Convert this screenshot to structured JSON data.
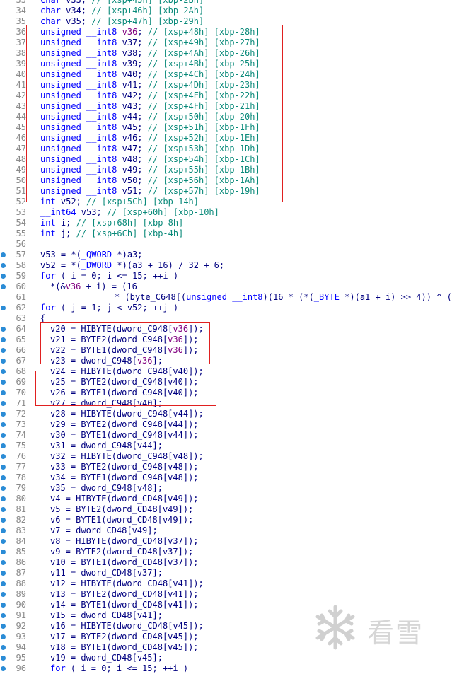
{
  "code_lines": [
    {
      "n": "33",
      "dot": false,
      "indent": 0,
      "tokens": [
        [
          "kw",
          "char"
        ],
        [
          "d",
          " v33; "
        ],
        [
          "com",
          "// [xsp+45h] [xbp-2Bh]"
        ]
      ]
    },
    {
      "n": "34",
      "dot": false,
      "indent": 0,
      "tokens": [
        [
          "kw",
          "char"
        ],
        [
          "d",
          " v34; "
        ],
        [
          "com",
          "// [xsp+46h] [xbp-2Ah]"
        ]
      ]
    },
    {
      "n": "35",
      "dot": false,
      "indent": 0,
      "tokens": [
        [
          "kw",
          "char"
        ],
        [
          "d",
          " v35; "
        ],
        [
          "com",
          "// [xsp+47h] [xbp-29h]"
        ]
      ]
    },
    {
      "n": "36",
      "dot": false,
      "indent": 0,
      "tokens": [
        [
          "kw",
          "unsigned"
        ],
        [
          "d",
          " "
        ],
        [
          "kw",
          "__int8"
        ],
        [
          "d",
          " "
        ],
        [
          "hl",
          "v36"
        ],
        [
          "d",
          "; "
        ],
        [
          "com",
          "// [xsp+48h] [xbp-28h]"
        ]
      ]
    },
    {
      "n": "37",
      "dot": false,
      "indent": 0,
      "tokens": [
        [
          "kw",
          "unsigned"
        ],
        [
          "d",
          " "
        ],
        [
          "kw",
          "__int8"
        ],
        [
          "d",
          " v37; "
        ],
        [
          "com",
          "// [xsp+49h] [xbp-27h]"
        ]
      ]
    },
    {
      "n": "38",
      "dot": false,
      "indent": 0,
      "tokens": [
        [
          "kw",
          "unsigned"
        ],
        [
          "d",
          " "
        ],
        [
          "kw",
          "__int8"
        ],
        [
          "d",
          " v38; "
        ],
        [
          "com",
          "// [xsp+4Ah] [xbp-26h]"
        ]
      ]
    },
    {
      "n": "39",
      "dot": false,
      "indent": 0,
      "tokens": [
        [
          "kw",
          "unsigned"
        ],
        [
          "d",
          " "
        ],
        [
          "kw",
          "__int8"
        ],
        [
          "d",
          " v39; "
        ],
        [
          "com",
          "// [xsp+4Bh] [xbp-25h]"
        ]
      ]
    },
    {
      "n": "40",
      "dot": false,
      "indent": 0,
      "tokens": [
        [
          "kw",
          "unsigned"
        ],
        [
          "d",
          " "
        ],
        [
          "kw",
          "__int8"
        ],
        [
          "d",
          " v40; "
        ],
        [
          "com",
          "// [xsp+4Ch] [xbp-24h]"
        ]
      ]
    },
    {
      "n": "41",
      "dot": false,
      "indent": 0,
      "tokens": [
        [
          "kw",
          "unsigned"
        ],
        [
          "d",
          " "
        ],
        [
          "kw",
          "__int8"
        ],
        [
          "d",
          " v41; "
        ],
        [
          "com",
          "// [xsp+4Dh] [xbp-23h]"
        ]
      ]
    },
    {
      "n": "42",
      "dot": false,
      "indent": 0,
      "tokens": [
        [
          "kw",
          "unsigned"
        ],
        [
          "d",
          " "
        ],
        [
          "kw",
          "__int8"
        ],
        [
          "d",
          " v42; "
        ],
        [
          "com",
          "// [xsp+4Eh] [xbp-22h]"
        ]
      ]
    },
    {
      "n": "43",
      "dot": false,
      "indent": 0,
      "tokens": [
        [
          "kw",
          "unsigned"
        ],
        [
          "d",
          " "
        ],
        [
          "kw",
          "__int8"
        ],
        [
          "d",
          " v43; "
        ],
        [
          "com",
          "// [xsp+4Fh] [xbp-21h]"
        ]
      ]
    },
    {
      "n": "44",
      "dot": false,
      "indent": 0,
      "tokens": [
        [
          "kw",
          "unsigned"
        ],
        [
          "d",
          " "
        ],
        [
          "kw",
          "__int8"
        ],
        [
          "d",
          " v44; "
        ],
        [
          "com",
          "// [xsp+50h] [xbp-20h]"
        ]
      ]
    },
    {
      "n": "45",
      "dot": false,
      "indent": 0,
      "tokens": [
        [
          "kw",
          "unsigned"
        ],
        [
          "d",
          " "
        ],
        [
          "kw",
          "__int8"
        ],
        [
          "d",
          " v45; "
        ],
        [
          "com",
          "// [xsp+51h] [xbp-1Fh]"
        ]
      ]
    },
    {
      "n": "46",
      "dot": false,
      "indent": 0,
      "tokens": [
        [
          "kw",
          "unsigned"
        ],
        [
          "d",
          " "
        ],
        [
          "kw",
          "__int8"
        ],
        [
          "d",
          " v46; "
        ],
        [
          "com",
          "// [xsp+52h] [xbp-1Eh]"
        ]
      ]
    },
    {
      "n": "47",
      "dot": false,
      "indent": 0,
      "tokens": [
        [
          "kw",
          "unsigned"
        ],
        [
          "d",
          " "
        ],
        [
          "kw",
          "__int8"
        ],
        [
          "d",
          " v47; "
        ],
        [
          "com",
          "// [xsp+53h] [xbp-1Dh]"
        ]
      ]
    },
    {
      "n": "48",
      "dot": false,
      "indent": 0,
      "tokens": [
        [
          "kw",
          "unsigned"
        ],
        [
          "d",
          " "
        ],
        [
          "kw",
          "__int8"
        ],
        [
          "d",
          " v48; "
        ],
        [
          "com",
          "// [xsp+54h] [xbp-1Ch]"
        ]
      ]
    },
    {
      "n": "49",
      "dot": false,
      "indent": 0,
      "tokens": [
        [
          "kw",
          "unsigned"
        ],
        [
          "d",
          " "
        ],
        [
          "kw",
          "__int8"
        ],
        [
          "d",
          " v49; "
        ],
        [
          "com",
          "// [xsp+55h] [xbp-1Bh]"
        ]
      ]
    },
    {
      "n": "50",
      "dot": false,
      "indent": 0,
      "tokens": [
        [
          "kw",
          "unsigned"
        ],
        [
          "d",
          " "
        ],
        [
          "kw",
          "__int8"
        ],
        [
          "d",
          " v50; "
        ],
        [
          "com",
          "// [xsp+56h] [xbp-1Ah]"
        ]
      ]
    },
    {
      "n": "51",
      "dot": false,
      "indent": 0,
      "tokens": [
        [
          "kw",
          "unsigned"
        ],
        [
          "d",
          " "
        ],
        [
          "kw",
          "__int8"
        ],
        [
          "d",
          " v51; "
        ],
        [
          "com",
          "// [xsp+57h] [xbp-19h]"
        ]
      ]
    },
    {
      "n": "52",
      "dot": false,
      "indent": 0,
      "tokens": [
        [
          "kw",
          "int"
        ],
        [
          "d",
          " v52; "
        ],
        [
          "com",
          "// [xsp+5Ch] [xbp-14h]"
        ]
      ]
    },
    {
      "n": "53",
      "dot": false,
      "indent": 0,
      "tokens": [
        [
          "kw",
          "__int64"
        ],
        [
          "d",
          " v53; "
        ],
        [
          "com",
          "// [xsp+60h] [xbp-10h]"
        ]
      ]
    },
    {
      "n": "54",
      "dot": false,
      "indent": 0,
      "tokens": [
        [
          "kw",
          "int"
        ],
        [
          "d",
          " i; "
        ],
        [
          "com",
          "// [xsp+68h] [xbp-8h]"
        ]
      ]
    },
    {
      "n": "55",
      "dot": false,
      "indent": 0,
      "tokens": [
        [
          "kw",
          "int"
        ],
        [
          "d",
          " j; "
        ],
        [
          "com",
          "// [xsp+6Ch] [xbp-4h]"
        ]
      ]
    },
    {
      "n": "56",
      "dot": false,
      "indent": 0,
      "tokens": []
    },
    {
      "n": "57",
      "dot": true,
      "indent": 0,
      "tokens": [
        [
          "d",
          "v53 = *("
        ],
        [
          "kw",
          "_QWORD"
        ],
        [
          "d",
          " *)a3;"
        ]
      ]
    },
    {
      "n": "58",
      "dot": true,
      "indent": 0,
      "tokens": [
        [
          "d",
          "v52 = *("
        ],
        [
          "kw",
          "_DWORD"
        ],
        [
          "d",
          " *)(a3 + 16) / 32 + 6;"
        ]
      ]
    },
    {
      "n": "59",
      "dot": true,
      "indent": 0,
      "tokens": [
        [
          "kw",
          "for"
        ],
        [
          "d",
          " ( i = 0; i <= 15; ++i )"
        ]
      ]
    },
    {
      "n": "60",
      "dot": true,
      "indent": 2,
      "tokens": [
        [
          "d",
          "*(&"
        ],
        [
          "hl",
          "v36"
        ],
        [
          "d",
          " + i) = (16"
        ]
      ]
    },
    {
      "n": "61",
      "dot": false,
      "indent": 15,
      "tokens": [
        [
          "d",
          "* (byte_C648[("
        ],
        [
          "kw",
          "unsigned"
        ],
        [
          "d",
          " "
        ],
        [
          "kw",
          "__int8"
        ],
        [
          "d",
          ")(16 * (*("
        ],
        [
          "kw",
          "_BYTE"
        ],
        [
          "d",
          " *)(a1 + i) >> 4)) ^ (*("
        ]
      ]
    },
    {
      "n": "62",
      "dot": true,
      "indent": 0,
      "tokens": [
        [
          "kw",
          "for"
        ],
        [
          "d",
          " ( j = 1; j < v52; ++j )"
        ]
      ]
    },
    {
      "n": "63",
      "dot": false,
      "indent": 0,
      "tokens": [
        [
          "d",
          "{"
        ]
      ]
    },
    {
      "n": "64",
      "dot": true,
      "indent": 2,
      "tokens": [
        [
          "d",
          "v20 = HIBYTE(dword_C948["
        ],
        [
          "hl",
          "v36"
        ],
        [
          "d",
          "]);"
        ]
      ]
    },
    {
      "n": "65",
      "dot": true,
      "indent": 2,
      "tokens": [
        [
          "d",
          "v21 = BYTE2(dword_C948["
        ],
        [
          "hl",
          "v36"
        ],
        [
          "d",
          "]);"
        ]
      ]
    },
    {
      "n": "66",
      "dot": true,
      "indent": 2,
      "tokens": [
        [
          "d",
          "v22 = BYTE1(dword_C948["
        ],
        [
          "hl",
          "v36"
        ],
        [
          "d",
          "]);"
        ]
      ]
    },
    {
      "n": "67",
      "dot": true,
      "indent": 2,
      "tokens": [
        [
          "d",
          "v23 = dword_C948["
        ],
        [
          "hl",
          "v36"
        ],
        [
          "d",
          "];"
        ]
      ]
    },
    {
      "n": "68",
      "dot": true,
      "indent": 2,
      "tokens": [
        [
          "d",
          "v24 = HIBYTE(dword_C948[v40]);"
        ]
      ]
    },
    {
      "n": "69",
      "dot": true,
      "indent": 2,
      "tokens": [
        [
          "d",
          "v25 = BYTE2(dword_C948[v40]);"
        ]
      ]
    },
    {
      "n": "70",
      "dot": true,
      "indent": 2,
      "tokens": [
        [
          "d",
          "v26 = BYTE1(dword_C948[v40]);"
        ]
      ]
    },
    {
      "n": "71",
      "dot": true,
      "indent": 2,
      "tokens": [
        [
          "d",
          "v27 = dword_C948[v40];"
        ]
      ]
    },
    {
      "n": "72",
      "dot": true,
      "indent": 2,
      "tokens": [
        [
          "d",
          "v28 = HIBYTE(dword_C948[v44]);"
        ]
      ]
    },
    {
      "n": "73",
      "dot": true,
      "indent": 2,
      "tokens": [
        [
          "d",
          "v29 = BYTE2(dword_C948[v44]);"
        ]
      ]
    },
    {
      "n": "74",
      "dot": true,
      "indent": 2,
      "tokens": [
        [
          "d",
          "v30 = BYTE1(dword_C948[v44]);"
        ]
      ]
    },
    {
      "n": "75",
      "dot": true,
      "indent": 2,
      "tokens": [
        [
          "d",
          "v31 = dword_C948[v44];"
        ]
      ]
    },
    {
      "n": "76",
      "dot": true,
      "indent": 2,
      "tokens": [
        [
          "d",
          "v32 = HIBYTE(dword_C948[v48]);"
        ]
      ]
    },
    {
      "n": "77",
      "dot": true,
      "indent": 2,
      "tokens": [
        [
          "d",
          "v33 = BYTE2(dword_C948[v48]);"
        ]
      ]
    },
    {
      "n": "78",
      "dot": true,
      "indent": 2,
      "tokens": [
        [
          "d",
          "v34 = BYTE1(dword_C948[v48]);"
        ]
      ]
    },
    {
      "n": "79",
      "dot": true,
      "indent": 2,
      "tokens": [
        [
          "d",
          "v35 = dword_C948[v48];"
        ]
      ]
    },
    {
      "n": "80",
      "dot": true,
      "indent": 2,
      "tokens": [
        [
          "d",
          "v4 = HIBYTE(dword_CD48[v49]);"
        ]
      ]
    },
    {
      "n": "81",
      "dot": true,
      "indent": 2,
      "tokens": [
        [
          "d",
          "v5 = BYTE2(dword_CD48[v49]);"
        ]
      ]
    },
    {
      "n": "82",
      "dot": true,
      "indent": 2,
      "tokens": [
        [
          "d",
          "v6 = BYTE1(dword_CD48[v49]);"
        ]
      ]
    },
    {
      "n": "83",
      "dot": true,
      "indent": 2,
      "tokens": [
        [
          "d",
          "v7 = dword_CD48[v49];"
        ]
      ]
    },
    {
      "n": "84",
      "dot": true,
      "indent": 2,
      "tokens": [
        [
          "d",
          "v8 = HIBYTE(dword_CD48[v37]);"
        ]
      ]
    },
    {
      "n": "85",
      "dot": true,
      "indent": 2,
      "tokens": [
        [
          "d",
          "v9 = BYTE2(dword_CD48[v37]);"
        ]
      ]
    },
    {
      "n": "86",
      "dot": true,
      "indent": 2,
      "tokens": [
        [
          "d",
          "v10 = BYTE1(dword_CD48[v37]);"
        ]
      ]
    },
    {
      "n": "87",
      "dot": true,
      "indent": 2,
      "tokens": [
        [
          "d",
          "v11 = dword_CD48[v37];"
        ]
      ]
    },
    {
      "n": "88",
      "dot": true,
      "indent": 2,
      "tokens": [
        [
          "d",
          "v12 = HIBYTE(dword_CD48[v41]);"
        ]
      ]
    },
    {
      "n": "89",
      "dot": true,
      "indent": 2,
      "tokens": [
        [
          "d",
          "v13 = BYTE2(dword_CD48[v41]);"
        ]
      ]
    },
    {
      "n": "90",
      "dot": true,
      "indent": 2,
      "tokens": [
        [
          "d",
          "v14 = BYTE1(dword_CD48[v41]);"
        ]
      ]
    },
    {
      "n": "91",
      "dot": true,
      "indent": 2,
      "tokens": [
        [
          "d",
          "v15 = dword_CD48[v41];"
        ]
      ]
    },
    {
      "n": "92",
      "dot": true,
      "indent": 2,
      "tokens": [
        [
          "d",
          "v16 = HIBYTE(dword_CD48[v45]);"
        ]
      ]
    },
    {
      "n": "93",
      "dot": true,
      "indent": 2,
      "tokens": [
        [
          "d",
          "v17 = BYTE2(dword_CD48[v45]);"
        ]
      ]
    },
    {
      "n": "94",
      "dot": true,
      "indent": 2,
      "tokens": [
        [
          "d",
          "v18 = BYTE1(dword_CD48[v45]);"
        ]
      ]
    },
    {
      "n": "95",
      "dot": true,
      "indent": 2,
      "tokens": [
        [
          "d",
          "v19 = dword_CD48[v45];"
        ]
      ]
    },
    {
      "n": "96",
      "dot": true,
      "indent": 2,
      "tokens": [
        [
          "kw",
          "for"
        ],
        [
          "d",
          " ( i = 0; i <= 15; ++i )"
        ]
      ]
    }
  ],
  "watermark": {
    "text": "看雪",
    "icon": "snowflake-icon"
  },
  "colors": {
    "background": "#ffffff",
    "keyword": "#0000ff",
    "identifier": "#000080",
    "comment": "#0a8a7a",
    "highlight": "#800080",
    "annotation_box": "#e02020",
    "breakpoint_dot": "#2b8cd6"
  }
}
